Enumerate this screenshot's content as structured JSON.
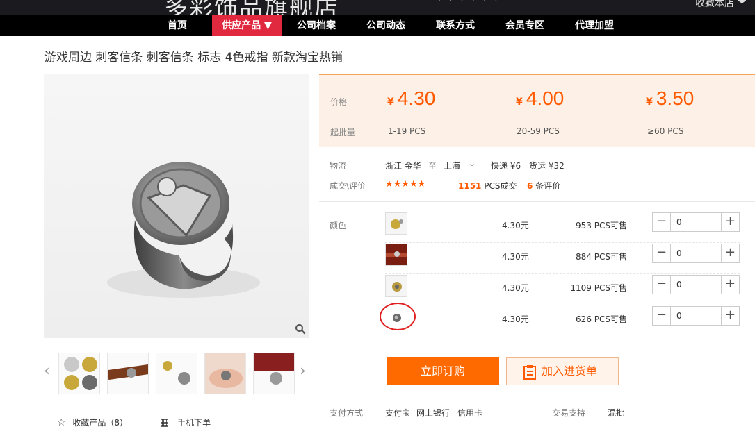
{
  "header": {
    "shop_name": "多彩饰品旗舰店",
    "favorite_label": "收藏本店"
  },
  "nav": {
    "items": [
      {
        "label": "首页"
      },
      {
        "label": "供应产品 ▼"
      },
      {
        "label": "公司档案"
      },
      {
        "label": "公司动态"
      },
      {
        "label": "联系方式"
      },
      {
        "label": "会员专区"
      },
      {
        "label": "代理加盟"
      }
    ]
  },
  "product": {
    "title": "游戏周边 刺客信条 刺客信条 标志 4色戒指 新款淘宝热销"
  },
  "gallery": {
    "prev_arrow": "‹",
    "next_arrow": "›"
  },
  "bottom": {
    "favorite_label": "收藏产品（8）",
    "mobile_order_label": "手机下单"
  },
  "pricing": {
    "price_label": "价格",
    "batch_label": "起批量",
    "currency": "¥",
    "tiers": [
      {
        "price": "4.30",
        "range": "1-19  PCS"
      },
      {
        "price": "4.00",
        "range": "20-59  PCS"
      },
      {
        "price": "3.50",
        "range": "≥60  PCS"
      }
    ]
  },
  "logistics": {
    "label": "物流",
    "from": "浙江 金华",
    "to_word": "至",
    "to": "上海",
    "express": "快递 ¥6",
    "freight": "货运 ¥32"
  },
  "deals": {
    "label": "成交\\评价",
    "stars": "★★★★★",
    "count": "1151",
    "count_suffix": "PCS成交",
    "reviews": "6",
    "reviews_suffix": "条评价"
  },
  "variants": {
    "label": "颜色",
    "items": [
      {
        "price": "4.30元",
        "stock": "953 PCS可售",
        "qty": "0"
      },
      {
        "price": "4.30元",
        "stock": "884 PCS可售",
        "qty": "0"
      },
      {
        "price": "4.30元",
        "stock": "1109 PCS可售",
        "qty": "0"
      },
      {
        "price": "4.30元",
        "stock": "626 PCS可售",
        "qty": "0"
      }
    ]
  },
  "actions": {
    "buy_label": "立即订购",
    "cart_label": "加入进货单"
  },
  "payment": {
    "label": "支付方式",
    "methods": [
      "支付宝",
      "网上银行",
      "信用卡"
    ],
    "trade_label": "交易支持",
    "trade_value": "混批"
  },
  "colors": {
    "accent": "#ff6a00",
    "nav_active": "#e0283e"
  }
}
